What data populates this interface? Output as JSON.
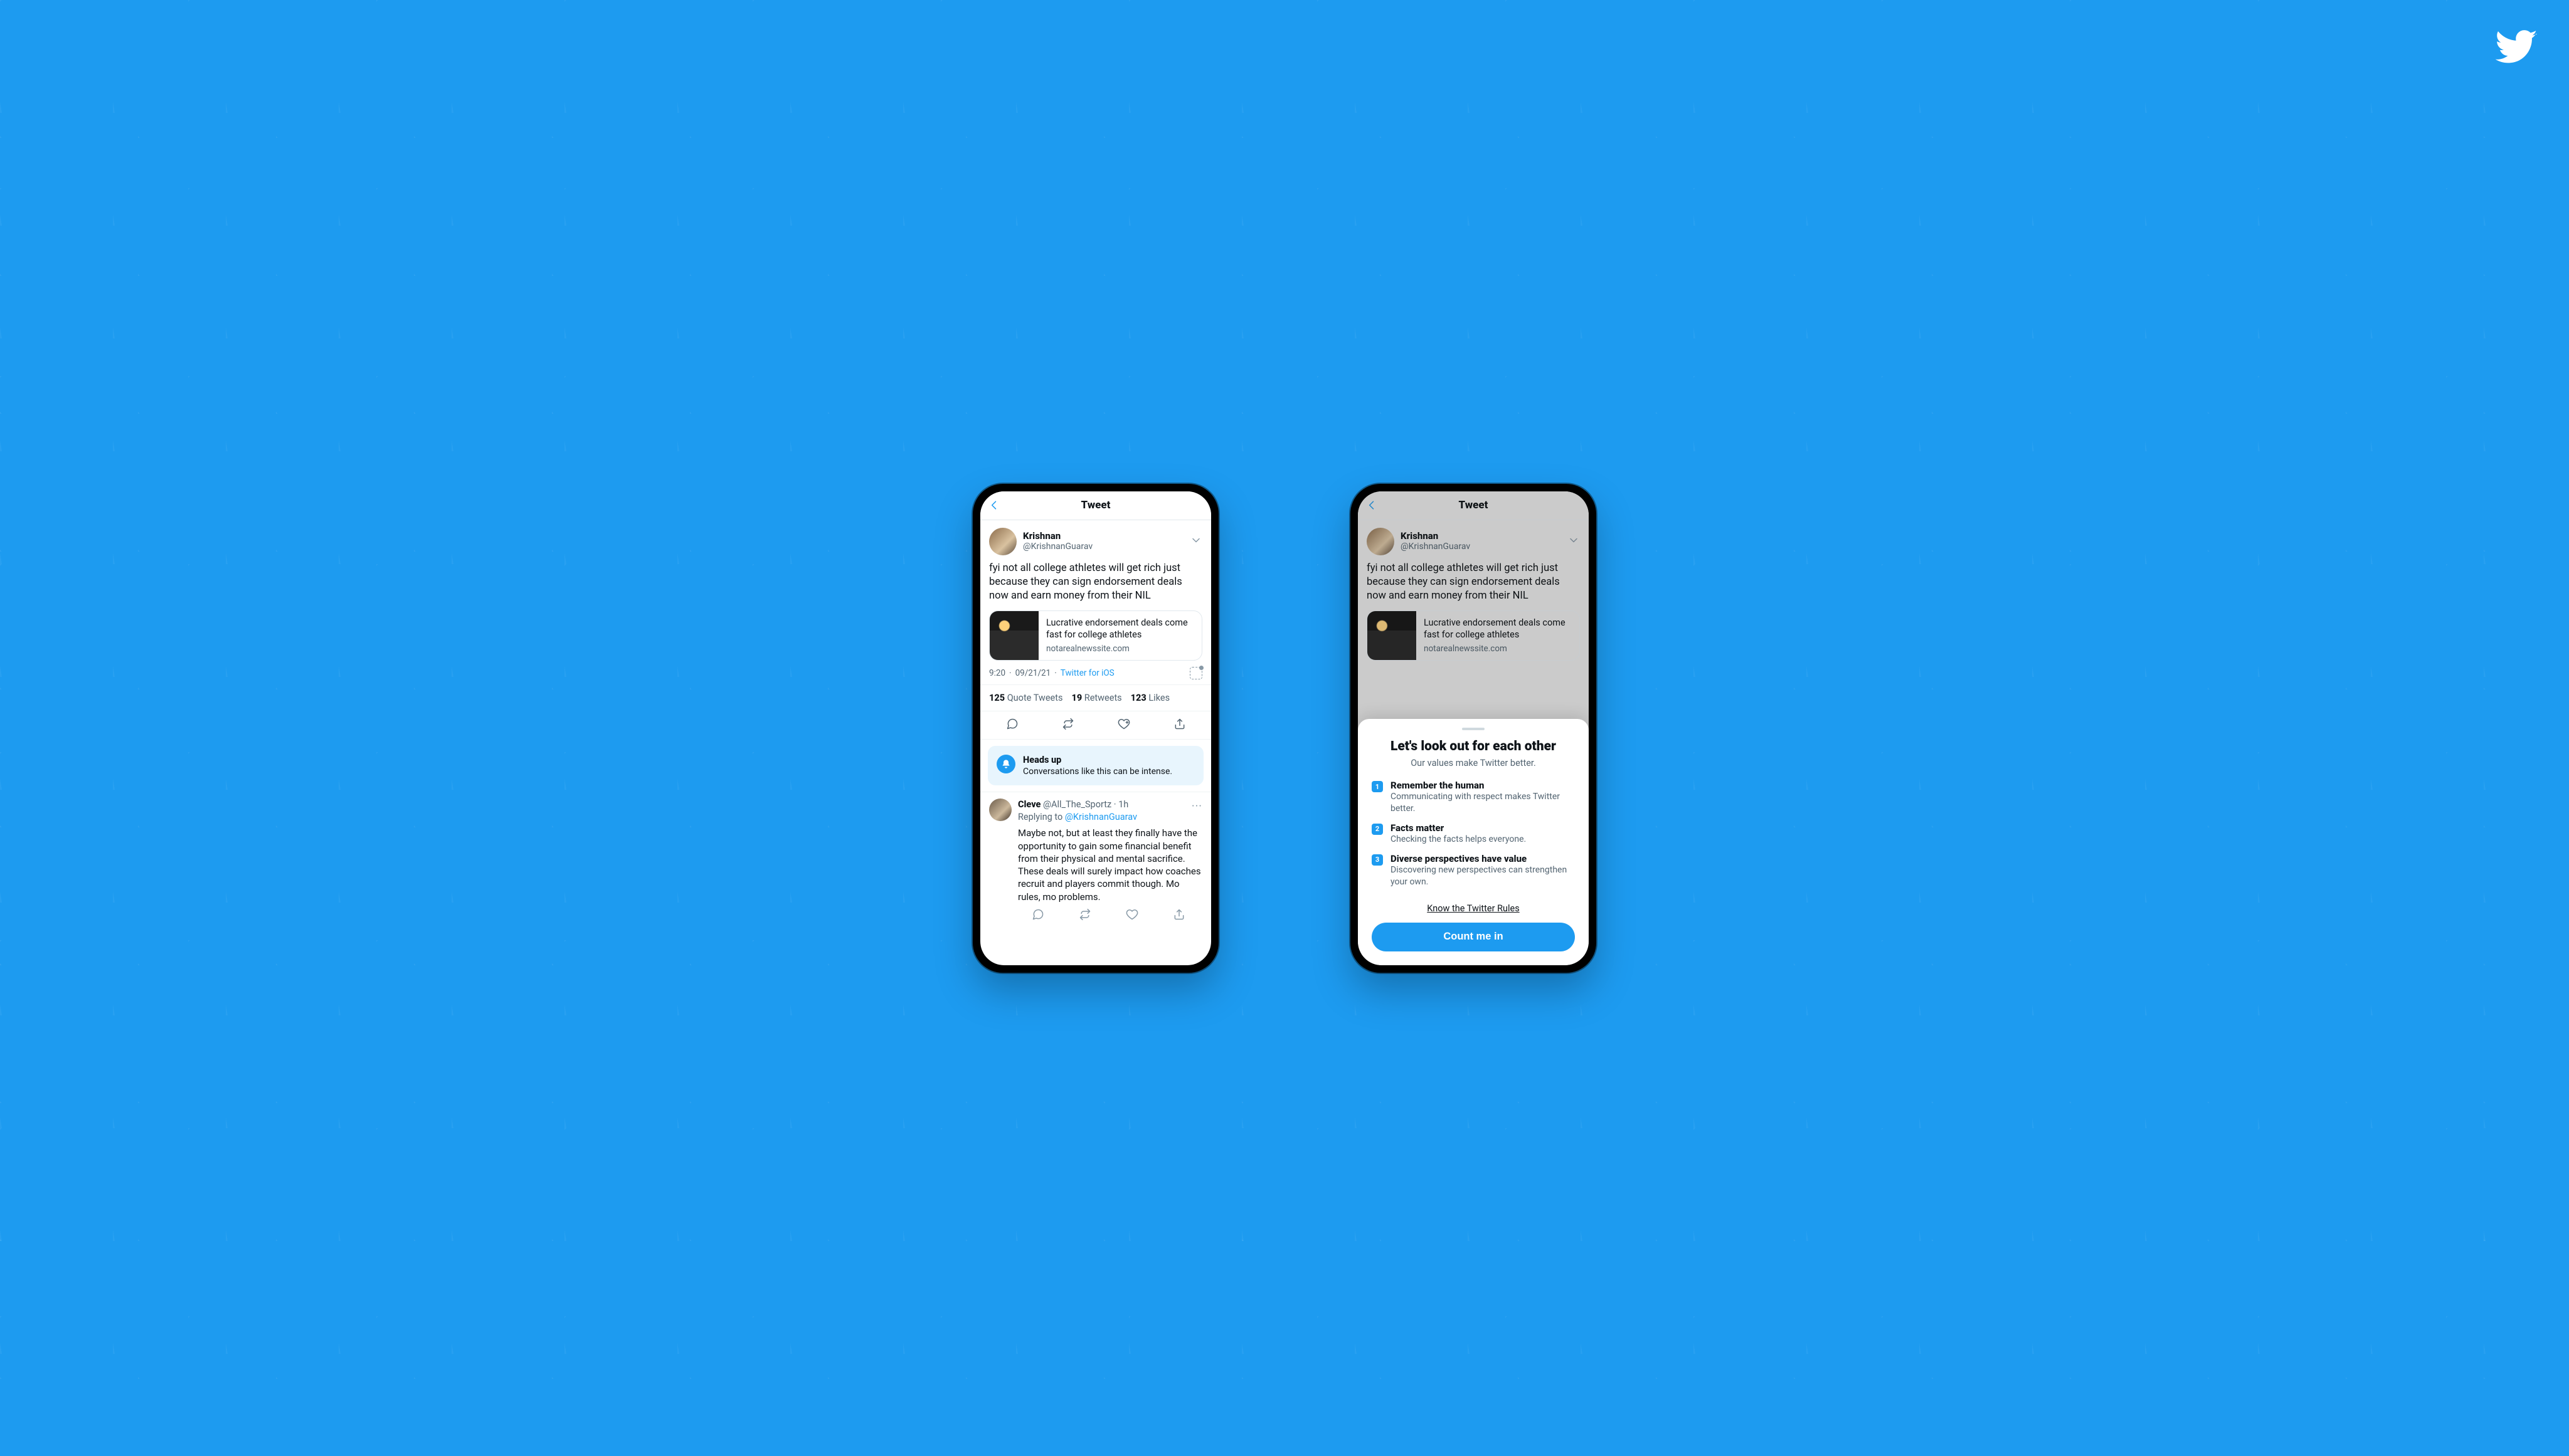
{
  "nav": {
    "title": "Tweet"
  },
  "tweet": {
    "author_name": "Krishnan",
    "author_handle": "@KrishnanGuarav",
    "body": "fyi not all college athletes will get rich just because they can sign endorsement deals now and earn money from their NIL",
    "card_title": "Lucrative endorsement deals come fast for college athletes",
    "card_domain": "notarealnewssite.com",
    "time": "9:20",
    "date": "09/21/21",
    "source": "Twitter for iOS"
  },
  "counts": {
    "quote_n": "125",
    "quote_l": "Quote Tweets",
    "rt_n": "19",
    "rt_l": "Retweets",
    "like_n": "123",
    "like_l": "Likes"
  },
  "banner": {
    "title": "Heads up",
    "desc": "Conversations like this can be intense."
  },
  "reply": {
    "name": "Cleve",
    "handle": "@All_The_Sportz",
    "age": "1h",
    "replying_prefix": "Replying to ",
    "replying_to": "@KrishnanGuarav",
    "body": "Maybe not, but at least they finally have the opportunity to gain some financial benefit from their physical and mental sacrifice. These deals will surely impact how coaches recruit and players commit though. Mo rules, mo problems."
  },
  "sheet": {
    "title": "Let's look out for each other",
    "subtitle": "Our values make Twitter better.",
    "items": [
      {
        "n": "1",
        "t": "Remember the human",
        "d": "Communicating with respect makes Twitter better."
      },
      {
        "n": "2",
        "t": "Facts matter",
        "d": "Checking the facts helps everyone."
      },
      {
        "n": "3",
        "t": "Diverse perspectives have value",
        "d": "Discovering new perspectives can strengthen your own."
      }
    ],
    "rules_link": "Know the Twitter Rules",
    "cta": "Count me in"
  }
}
